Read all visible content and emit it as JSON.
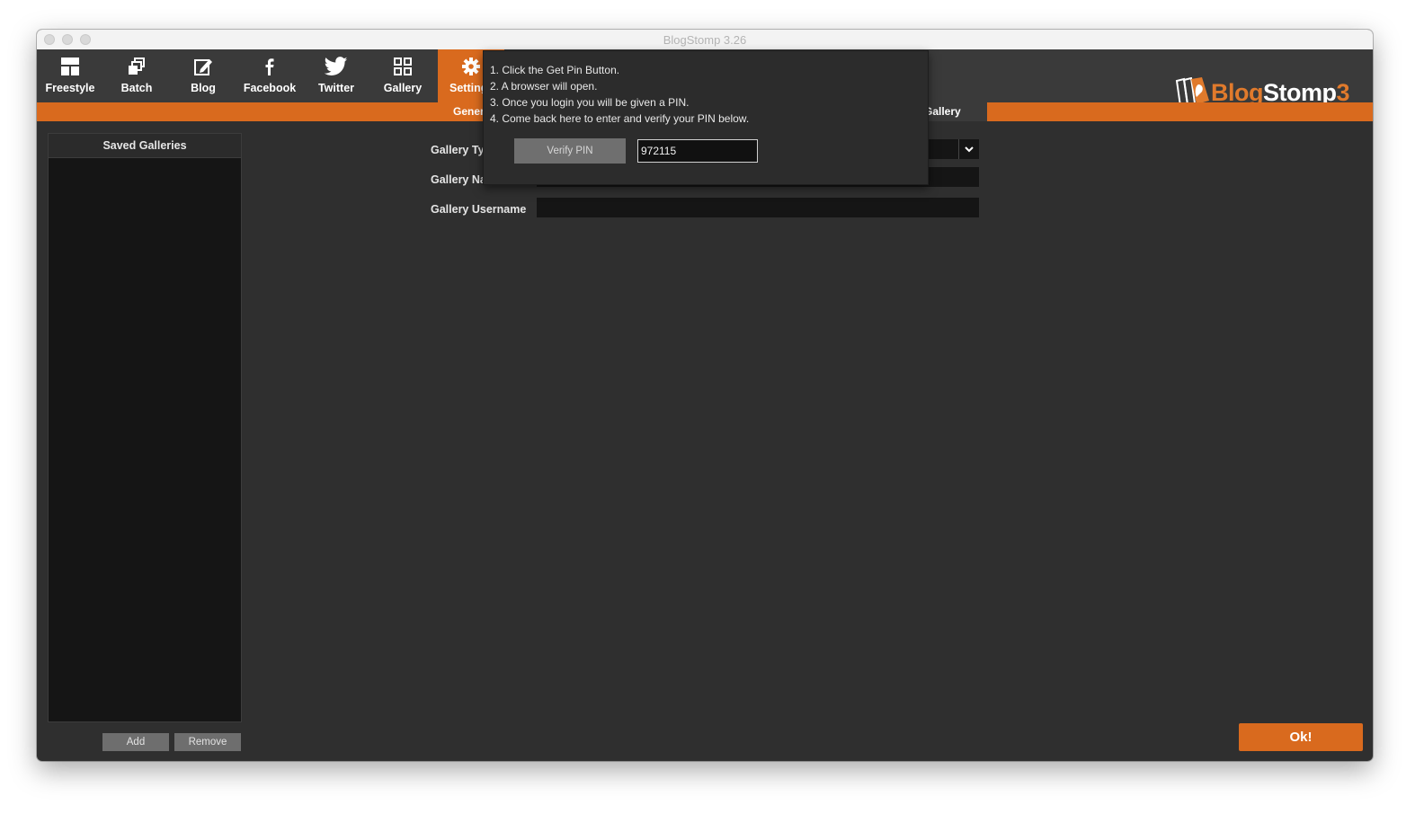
{
  "window": {
    "title": "BlogStomp 3.26"
  },
  "toolbar": {
    "items": [
      {
        "label": "Freestyle",
        "icon": "freestyle-icon"
      },
      {
        "label": "Batch",
        "icon": "batch-icon"
      },
      {
        "label": "Blog",
        "icon": "blog-edit-icon"
      },
      {
        "label": "Facebook",
        "icon": "facebook-icon"
      },
      {
        "label": "Twitter",
        "icon": "twitter-icon"
      },
      {
        "label": "Gallery",
        "icon": "gallery-grid-icon"
      },
      {
        "label": "Setting",
        "icon": "gear-icon",
        "active": true
      }
    ]
  },
  "logo": {
    "part1": "Blog",
    "part2": "Stomp",
    "part3": "3"
  },
  "subtabs": [
    {
      "label": "Gener"
    },
    {
      "label": "Gallery",
      "active": true
    }
  ],
  "sidebar": {
    "header": "Saved Galleries",
    "add_label": "Add",
    "remove_label": "Remove"
  },
  "form": {
    "gallery_type_label": "Gallery Typ",
    "gallery_name_label": "Gallery Na",
    "gallery_username_label": "Gallery Username"
  },
  "popup": {
    "steps": [
      "1. Click the Get Pin Button.",
      "2. A browser will open.",
      "3. Once you login you will be given a PIN.",
      "4. Come back here to enter and verify your PIN below."
    ],
    "verify_label": "Verify PIN",
    "pin_value": "972115"
  },
  "ok_label": "Ok!",
  "colors": {
    "accent": "#d96a1e",
    "background": "#2f2f2f",
    "toolbar": "#3a3a3a"
  }
}
